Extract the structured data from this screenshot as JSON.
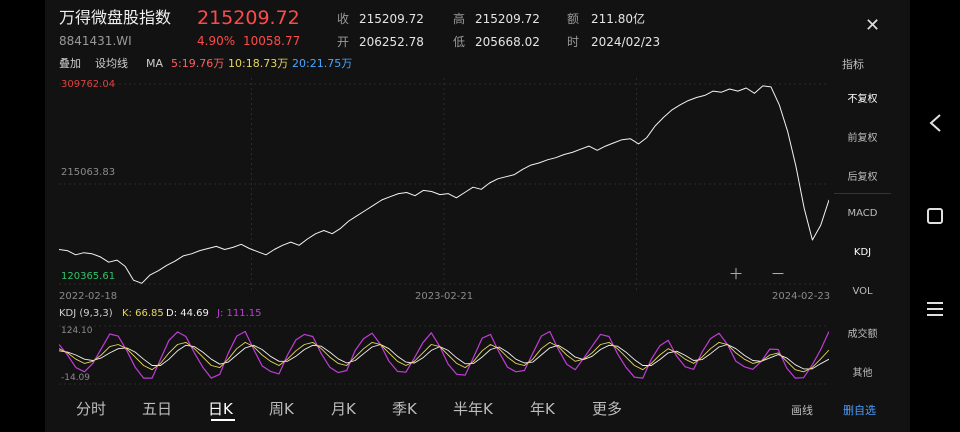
{
  "header": {
    "title": "万得微盘股指数",
    "code": "8841431.WI",
    "price": "215209.72",
    "change_pct": "4.90%",
    "change": "10058.77",
    "quote": [
      {
        "label": "收",
        "value": "215209.72"
      },
      {
        "label": "高",
        "value": "215209.72"
      },
      {
        "label": "额",
        "value": "211.80亿"
      },
      {
        "label": "开",
        "value": "206252.78"
      },
      {
        "label": "低",
        "value": "205668.02"
      },
      {
        "label": "时",
        "value": "2024/02/23"
      }
    ]
  },
  "toolbar": {
    "overlay": "叠加",
    "draw_line": "设均线",
    "ma_label": "MA",
    "ma5": "5:19.76万",
    "ma10": "10:18.73万",
    "ma20": "20:21.75万",
    "indicator": "指标"
  },
  "chart": {
    "max_label": "309762.04",
    "mid_label": "215063.83",
    "min_label": "120365.61",
    "dates": [
      "2022-02-18",
      "2023-02-21",
      "2024-02-23"
    ]
  },
  "kdj": {
    "header": "KDJ (9,3,3)",
    "k": "K: 66.85",
    "d": "D: 44.69",
    "j": "J: 111.15",
    "top_label": "124.10",
    "bottom_label": "-14.09"
  },
  "side_panel": {
    "items": [
      "不复权",
      "前复权",
      "后复权",
      "MACD",
      "KDJ",
      "VOL",
      "成交额",
      "其他"
    ],
    "active": [
      "不复权",
      "KDJ"
    ]
  },
  "tabs": {
    "items": [
      "分时",
      "五日",
      "日K",
      "周K",
      "月K",
      "季K",
      "半年K",
      "年K",
      "更多"
    ],
    "active": "日K",
    "draw": "画线",
    "mine": "删自选"
  },
  "colors": {
    "up": "#ff4a4a",
    "ma5": "#ff6060",
    "ma10": "#e6d65a",
    "ma20": "#49a6ff",
    "k_line": "#e6d65a",
    "d_line": "#f0f0f0",
    "j_line": "#c03cd8",
    "accent": "#4a9cff"
  },
  "icons": {
    "close": "close-icon",
    "zoom_in": "zoom-in-icon",
    "zoom_out": "zoom-out-icon",
    "nav_back": "back-icon",
    "nav_home": "home-icon",
    "nav_menu": "menu-icon"
  },
  "chart_data": [
    {
      "type": "line",
      "title": "",
      "x_ticks": [
        "2022-02-18",
        "2023-02-21",
        "2024-02-23"
      ],
      "ylim": [
        120365.61,
        309762.04
      ],
      "y_ticks": [
        120365.61,
        215063.83,
        309762.04
      ],
      "series": [
        {
          "values": [
            153000,
            152000,
            148000,
            150000,
            149000,
            146000,
            141000,
            143000,
            137000,
            124000,
            121000,
            129000,
            133000,
            138000,
            142000,
            147000,
            149000,
            152000,
            154000,
            156000,
            153000,
            155000,
            158000,
            154000,
            151000,
            148000,
            153000,
            157000,
            160000,
            157000,
            163000,
            168000,
            171000,
            168000,
            173000,
            180000,
            185000,
            190000,
            195000,
            200000,
            203000,
            206000,
            207000,
            204000,
            209000,
            208000,
            205000,
            206000,
            202000,
            207000,
            212000,
            210000,
            216000,
            220000,
            222000,
            224000,
            229000,
            233000,
            235000,
            238000,
            240000,
            243000,
            245000,
            248000,
            251000,
            247000,
            251000,
            254000,
            257000,
            258000,
            253000,
            259000,
            270000,
            278000,
            285000,
            290000,
            294000,
            297000,
            299000,
            303000,
            302000,
            305000,
            303000,
            306000,
            301000,
            308000,
            307000,
            290000,
            265000,
            232000,
            192000,
            162000,
            176000,
            200000
          ]
        }
      ]
    },
    {
      "type": "line",
      "title": "KDJ (9,3,3)",
      "ylim": [
        -14.09,
        124.1
      ],
      "series": [
        {
          "name": "K",
          "values": [
            70,
            60,
            45,
            35,
            40,
            55,
            75,
            80,
            70,
            50,
            30,
            20,
            35,
            60,
            80,
            85,
            70,
            50,
            30,
            25,
            45,
            70,
            85,
            75,
            55,
            40,
            30,
            45,
            65,
            80,
            85,
            70,
            50,
            35,
            30,
            50,
            70,
            85,
            80,
            60,
            40,
            30,
            40,
            60,
            80,
            75,
            55,
            35,
            25,
            40,
            65,
            80,
            70,
            50,
            35,
            30,
            45,
            70,
            85,
            75,
            55,
            40,
            45,
            60,
            80,
            85,
            70,
            50,
            30,
            20,
            35,
            55,
            70,
            60,
            45,
            35,
            50,
            70,
            85,
            80,
            60,
            45,
            35,
            40,
            55,
            60,
            40,
            20,
            15,
            25,
            45,
            67
          ]
        },
        {
          "name": "D",
          "values": [
            65,
            62,
            55,
            45,
            42,
            48,
            60,
            70,
            72,
            62,
            45,
            30,
            30,
            45,
            65,
            78,
            75,
            62,
            45,
            33,
            38,
            55,
            72,
            78,
            68,
            52,
            40,
            40,
            52,
            68,
            78,
            76,
            62,
            46,
            36,
            42,
            58,
            74,
            80,
            70,
            52,
            38,
            36,
            48,
            66,
            75,
            66,
            48,
            34,
            35,
            50,
            68,
            74,
            62,
            45,
            36,
            38,
            55,
            72,
            78,
            66,
            50,
            44,
            52,
            68,
            78,
            76,
            62,
            44,
            30,
            30,
            44,
            60,
            64,
            54,
            42,
            44,
            58,
            74,
            80,
            70,
            54,
            42,
            40,
            48,
            56,
            48,
            32,
            22,
            22,
            34,
            45
          ]
        },
        {
          "name": "J",
          "values": [
            80,
            55,
            25,
            15,
            35,
            70,
            105,
            100,
            66,
            26,
            0,
            0,
            45,
            90,
            110,
            99,
            60,
            26,
            0,
            9,
            59,
            100,
            111,
            69,
            29,
            16,
            10,
            55,
            91,
            104,
            99,
            58,
            26,
            13,
            18,
            66,
            94,
            107,
            80,
            40,
            16,
            14,
            48,
            84,
            108,
            75,
            33,
            9,
            7,
            50,
            95,
            104,
            62,
            26,
            15,
            18,
            59,
            100,
            111,
            69,
            33,
            20,
            47,
            76,
            104,
            99,
            58,
            26,
            2,
            0,
            45,
            77,
            90,
            52,
            27,
            21,
            62,
            94,
            107,
            80,
            40,
            27,
            21,
            40,
            69,
            68,
            24,
            0,
            1,
            31,
            67,
            111
          ]
        }
      ]
    }
  ]
}
